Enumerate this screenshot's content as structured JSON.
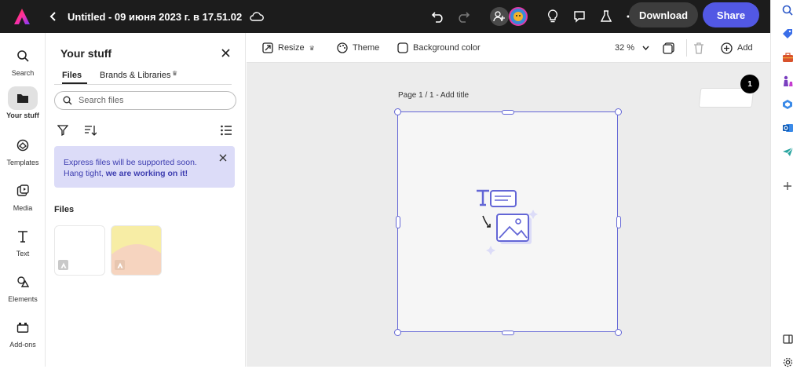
{
  "topbar": {
    "document_title": "Untitled - 09 июня 2023 г. в 17.51.02",
    "download_label": "Download",
    "share_label": "Share"
  },
  "left_rail": {
    "items": [
      {
        "label": "Search",
        "icon": "search-icon"
      },
      {
        "label": "Your stuff",
        "icon": "folder-icon",
        "active": true
      },
      {
        "label": "Templates",
        "icon": "templates-icon"
      },
      {
        "label": "Media",
        "icon": "media-icon"
      },
      {
        "label": "Text",
        "icon": "text-icon"
      },
      {
        "label": "Elements",
        "icon": "elements-icon"
      },
      {
        "label": "Add-ons",
        "icon": "addons-icon"
      }
    ]
  },
  "panel": {
    "title": "Your stuff",
    "tabs": [
      {
        "label": "Files",
        "active": true
      },
      {
        "label": "Brands & Libraries"
      }
    ],
    "search_placeholder": "Search files",
    "notice_text": "Express files will be supported soon. Hang tight, ",
    "notice_bold": "we are working on it!",
    "files_heading": "Files"
  },
  "toolbar": {
    "resize_label": "Resize",
    "theme_label": "Theme",
    "background_label": "Background color",
    "zoom": "32 %",
    "add_label": "Add"
  },
  "canvas": {
    "page_label": "Page 1 / 1 - Add title",
    "page_count": "1"
  },
  "colors": {
    "accent": "#5258e4",
    "topbar_bg": "#1c1c1c",
    "selection": "#6366d6",
    "notice_bg": "#dcdcf8"
  }
}
